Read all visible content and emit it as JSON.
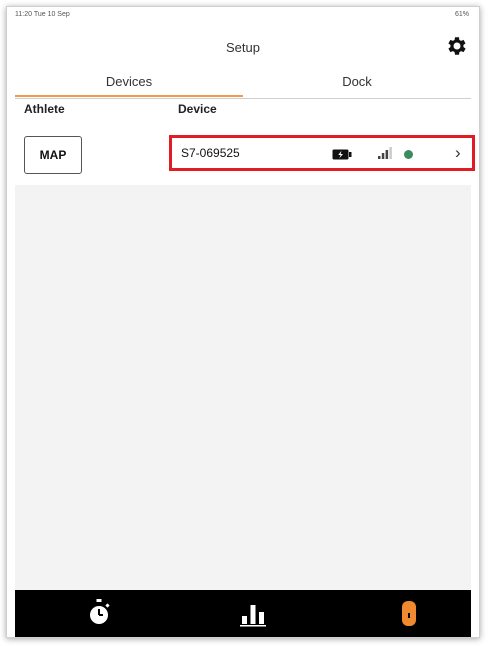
{
  "statusbar": {
    "time": "11:20 Tue 10 Sep",
    "battery": "61%"
  },
  "header": {
    "title": "Setup"
  },
  "tabs": [
    {
      "label": "Devices",
      "active": true
    },
    {
      "label": "Dock",
      "active": false
    }
  ],
  "columns": {
    "athlete": "Athlete",
    "device": "Device"
  },
  "rows": [
    {
      "athlete_button": "MAP",
      "device_name": "S7-069525"
    }
  ],
  "colors": {
    "accent": "#f29a52",
    "status_dot": "#3d8a5e",
    "highlight_border": "#e21c24",
    "tabbar_bg": "#000000",
    "tabbar_active": "#f08a30"
  },
  "tabbar": {
    "items": [
      "stopwatch-icon",
      "bar-chart-icon",
      "device-icon"
    ],
    "active": "device-icon"
  }
}
